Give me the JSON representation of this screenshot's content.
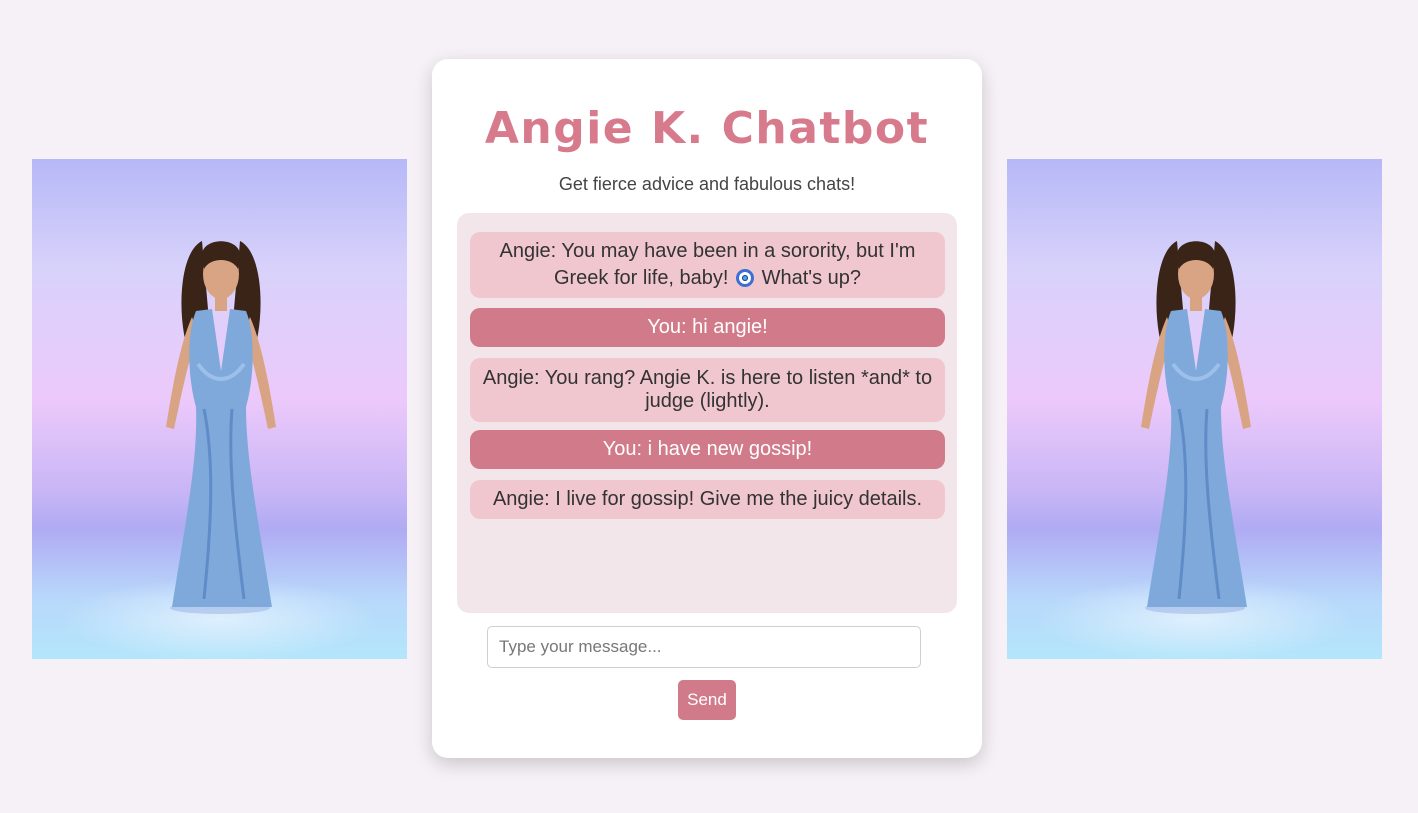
{
  "app": {
    "title": "Angie K. Chatbot",
    "subtitle": "Get fierce advice and fabulous chats!"
  },
  "messages": [
    {
      "sender": "bot",
      "text_before": "Angie: You may have been in a sorority, but I'm Greek for life, baby!",
      "icon": "nazar-evil-eye-icon",
      "text_after": "What's up?"
    },
    {
      "sender": "user",
      "text": "You: hi angie!"
    },
    {
      "sender": "bot",
      "text": "Angie: You rang? Angie K. is here to listen *and* to judge (lightly)."
    },
    {
      "sender": "user",
      "text": "You: i have new gossip!"
    },
    {
      "sender": "bot",
      "text": "Angie: I live for gossip! Give me the juicy details."
    }
  ],
  "composer": {
    "placeholder": "Type your message...",
    "value": "",
    "send_label": "Send"
  },
  "colors": {
    "page_background": "#f6f1f6",
    "accent": "#d17a8a",
    "title": "#d67a8c",
    "bot_bubble": "#f0c6cf",
    "chat_background": "#f3e6ea"
  }
}
